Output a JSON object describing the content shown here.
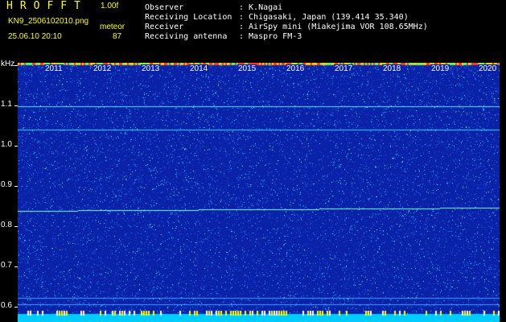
{
  "header": {
    "app_title": "HROFFT",
    "version": "1.00f",
    "filename": "KN9_2506102010.png",
    "mode": "meteor",
    "datetime": "25.06.10 20:10",
    "count": "87"
  },
  "info": {
    "labels": [
      "Observer",
      "Receiving Location",
      "Receiver",
      "Receiving antenna"
    ],
    "values": [
      ": K.Nagai",
      ": Chigasaki, Japan (139.414 35.340)",
      ": AirSpy mini (Miakejima VOR 108.65MHz)",
      ": Maspro FM-3"
    ]
  },
  "axis": {
    "unit": "kHz",
    "y_ticks": [
      "1.1",
      "1.0",
      "0.9",
      "0.8",
      "0.7",
      "0.6"
    ],
    "x_ticks": [
      "2011",
      "2012",
      "2013",
      "2014",
      "2015",
      "2016",
      "2017",
      "2018",
      "2019",
      "2020"
    ]
  },
  "colors": {
    "background": "#000000",
    "waterfall_base": "#0a22a8",
    "signal": "#00e0ff",
    "header_text": "#ffff00"
  }
}
